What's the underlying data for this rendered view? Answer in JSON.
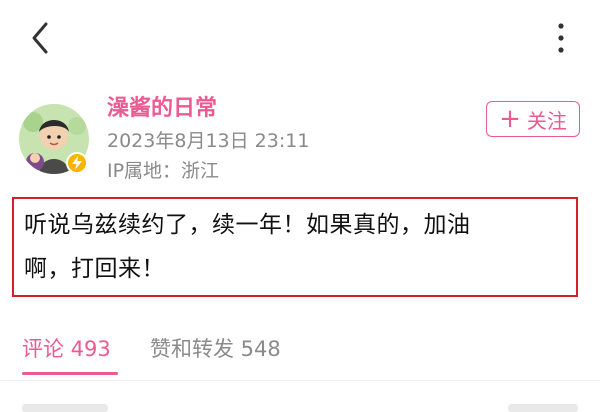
{
  "header": {
    "back_icon": "chevron-left-icon",
    "more_icon": "more-vertical-icon"
  },
  "author": {
    "name": "澡酱的日常",
    "post_time": "2023年8月13日 23:11",
    "ip_location": "IP属地：浙江",
    "badge_icon": "lightning-icon",
    "badge_color": "#f7b400"
  },
  "follow_button": {
    "plus": "+",
    "label": "关注"
  },
  "post": {
    "line1": "听说乌兹续约了，续一年！如果真的，加油",
    "line2": "啊，打回来！"
  },
  "tabs": {
    "comments_label": "评论 493",
    "likes_label": "赞和转发 548"
  },
  "colors": {
    "accent": "#ec5a93",
    "highlight_border": "#d61f28",
    "meta_text": "#8a8a8a"
  }
}
